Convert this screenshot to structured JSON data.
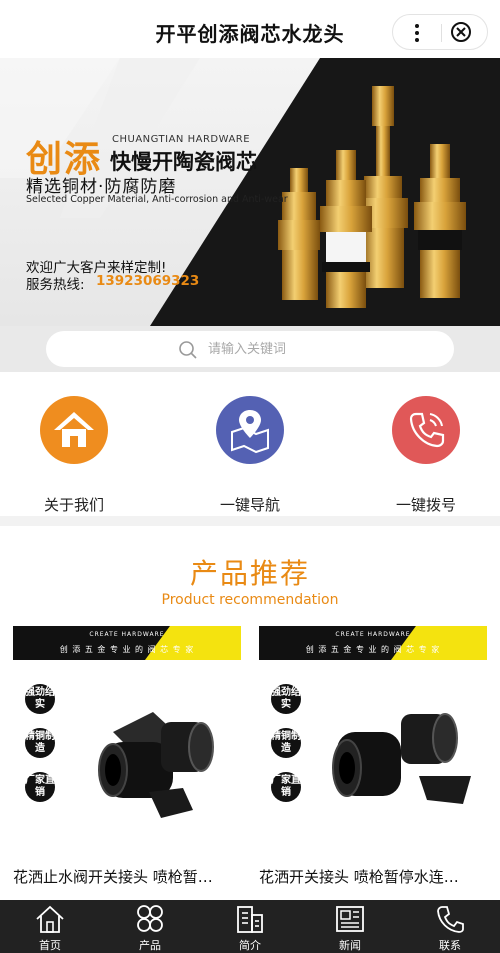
{
  "header": {
    "title": "开平创添阀芯水龙头"
  },
  "banner": {
    "brand_cn": "创添",
    "brand_en": "CHUANGTIAN HARDWARE",
    "slogan": "快慢开陶瓷阀芯",
    "subtitle_cn": "精选铜材·防腐防磨",
    "subtitle_en": "Selected Copper Material, Anti-corrosion and Anti-wear",
    "welcome": "欢迎广大客户来样定制!",
    "hotline_label": "服务热线:",
    "hotline_number": "13923069323"
  },
  "search": {
    "placeholder": "请输入关键词"
  },
  "quick_links": [
    {
      "label": "关于我们",
      "icon": "home-icon",
      "color": "#ef8d1f"
    },
    {
      "label": "一键导航",
      "icon": "map-pin-icon",
      "color": "#5461b3"
    },
    {
      "label": "一键拨号",
      "icon": "phone-icon",
      "color": "#e05858"
    }
  ],
  "products_section": {
    "title": "产品推荐",
    "subtitle": "Product recommendation",
    "items": [
      {
        "name": "花洒止水阀开关接头 喷枪暂…",
        "banner_en": "CREATE HARDWARE",
        "banner_cn": "创 添 五 金 专 业 的 阀 芯 专 家",
        "tags": [
          "强劲结实",
          "精铜制造",
          "厂家直销"
        ]
      },
      {
        "name": "花洒开关接头 喷枪暂停水连…",
        "banner_en": "CREATE HARDWARE",
        "banner_cn": "创 添 五 金 专 业 的 阀 芯 专 家",
        "tags": [
          "强劲结实",
          "精铜制造",
          "厂家直销"
        ]
      }
    ]
  },
  "tabbar": [
    {
      "label": "首页",
      "icon": "home-icon"
    },
    {
      "label": "产品",
      "icon": "grid-icon"
    },
    {
      "label": "简介",
      "icon": "building-icon"
    },
    {
      "label": "新闻",
      "icon": "newspaper-icon"
    },
    {
      "label": "联系",
      "icon": "phone-icon"
    }
  ],
  "colors": {
    "accent": "#e98a14",
    "tabbar": "#222222"
  }
}
